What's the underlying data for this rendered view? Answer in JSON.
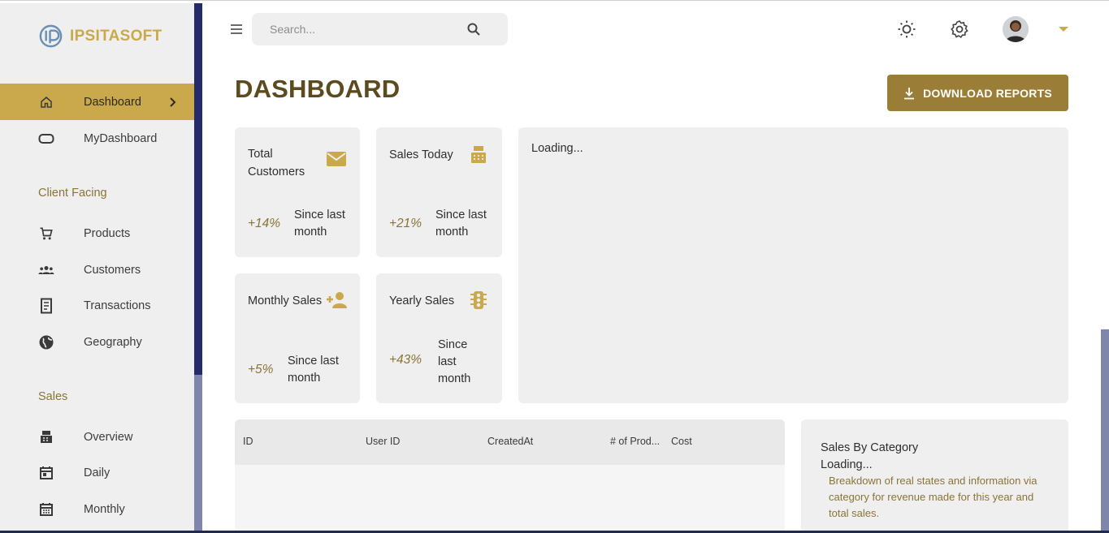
{
  "brand": {
    "name": "IPSITASOFT"
  },
  "colors": {
    "accent": "#c9a94c",
    "accent_dark": "#9a7d36",
    "sidebar_bg": "#efefef",
    "card_bg": "#efefef",
    "title": "#5b4b1e"
  },
  "sidebar": {
    "items": [
      {
        "label": "Dashboard",
        "icon": "home-icon",
        "active": true
      },
      {
        "label": "MyDashboard",
        "icon": "rounded-rect-icon"
      }
    ],
    "sections": [
      {
        "label": "Client Facing",
        "items": [
          {
            "label": "Products",
            "icon": "cart-icon"
          },
          {
            "label": "Customers",
            "icon": "group-icon"
          },
          {
            "label": "Transactions",
            "icon": "receipt-icon"
          },
          {
            "label": "Geography",
            "icon": "globe-icon"
          }
        ]
      },
      {
        "label": "Sales",
        "items": [
          {
            "label": "Overview",
            "icon": "register-icon"
          },
          {
            "label": "Daily",
            "icon": "calendar-today-icon"
          },
          {
            "label": "Monthly",
            "icon": "calendar-month-icon"
          }
        ]
      }
    ]
  },
  "topbar": {
    "search_placeholder": "Search..."
  },
  "page": {
    "title": "DASHBOARD",
    "download_label": "DOWNLOAD REPORTS"
  },
  "stats": [
    {
      "title": "Total Customers",
      "icon": "mail-icon",
      "increase": "+14%",
      "since": "Since last month"
    },
    {
      "title": "Sales Today",
      "icon": "point-of-sale-icon",
      "increase": "+21%",
      "since": "Since last month"
    },
    {
      "title": "Monthly Sales",
      "icon": "person-add-icon",
      "increase": "+5%",
      "since": "Since last month"
    },
    {
      "title": "Yearly Sales",
      "icon": "traffic-icon",
      "increase": "+43%",
      "since": "Since last month"
    }
  ],
  "overview_chart": {
    "status": "Loading..."
  },
  "transactions_table": {
    "columns": [
      "ID",
      "User ID",
      "CreatedAt",
      "# of Prod...",
      "Cost"
    ]
  },
  "sales_by_category": {
    "title": "Sales By Category",
    "status": "Loading...",
    "description": "Breakdown of real states and information via category for revenue made for this year and total sales."
  }
}
